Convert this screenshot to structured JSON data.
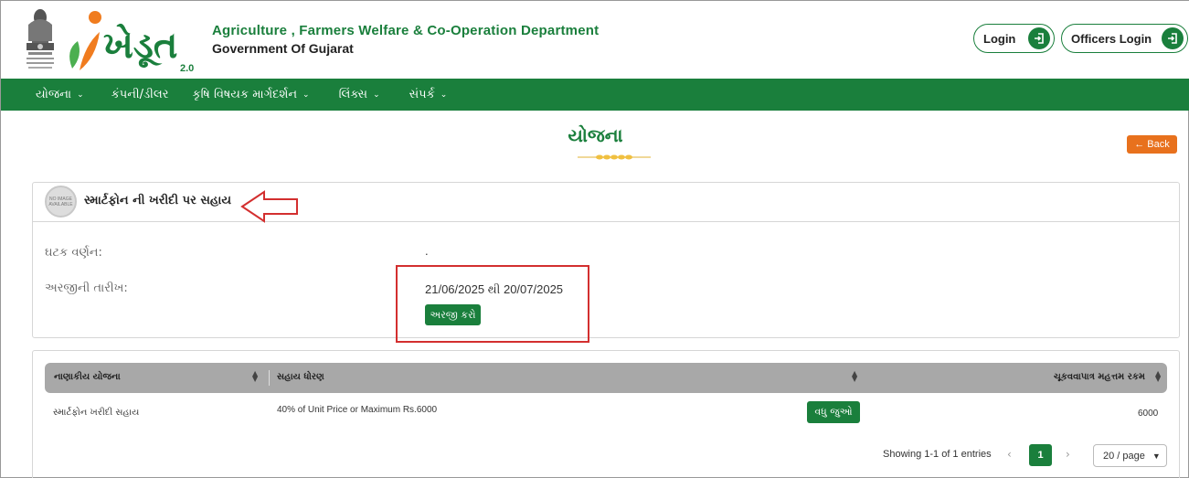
{
  "header": {
    "logo_text": "ખેડૂત",
    "logo_version": "2.0",
    "emblem_caption": "સત્યમેવ જયતે",
    "department": "Agriculture , Farmers Welfare & Co-Operation Department",
    "government": "Government Of Gujarat",
    "login_label": "Login",
    "officers_login_label": "Officers Login"
  },
  "nav": {
    "items": [
      {
        "label": "યોજના",
        "has_dropdown": true
      },
      {
        "label": "કંપની/ડીલર",
        "has_dropdown": false
      },
      {
        "label": "કૃષિ વિષયક માર્ગદર્શન",
        "has_dropdown": true
      },
      {
        "label": "લિંક્સ",
        "has_dropdown": true
      },
      {
        "label": "સંપર્ક",
        "has_dropdown": true
      }
    ],
    "chevron": "⌄"
  },
  "page": {
    "title": "યોજના",
    "back_label": "Back"
  },
  "scheme": {
    "no_image_text": "NO IMAGE AVAILABLE",
    "name": "સ્માર્ટફોન ની ખરીદી પર સહાય",
    "component_label": "ઘટક વર્ણન:",
    "component_value": ".",
    "date_label": "અરજીની તારીખ:",
    "date_value": "21/06/2025 થી 20/07/2025",
    "apply_label": "અરજી કરો"
  },
  "table": {
    "headers": [
      "નાણાકીય યોજના",
      "સહાય ધોરણ",
      "ચૂકવવાપાત્ર મહત્તમ રકમ"
    ],
    "rows": [
      {
        "scheme": "સ્માર્ટફોન ખરીદી સહાય",
        "norm": "40% of Unit Price or Maximum Rs.6000",
        "more_label": "વધુ જુઓ",
        "amount": "6000"
      }
    ]
  },
  "pagination": {
    "showing": "Showing 1-1 of 1 entries",
    "current_page": "1",
    "page_size": "20 / page"
  },
  "colors": {
    "brand_green": "#1a7f3c",
    "back_orange": "#e8711d",
    "annotation_red": "#d32f2f"
  }
}
